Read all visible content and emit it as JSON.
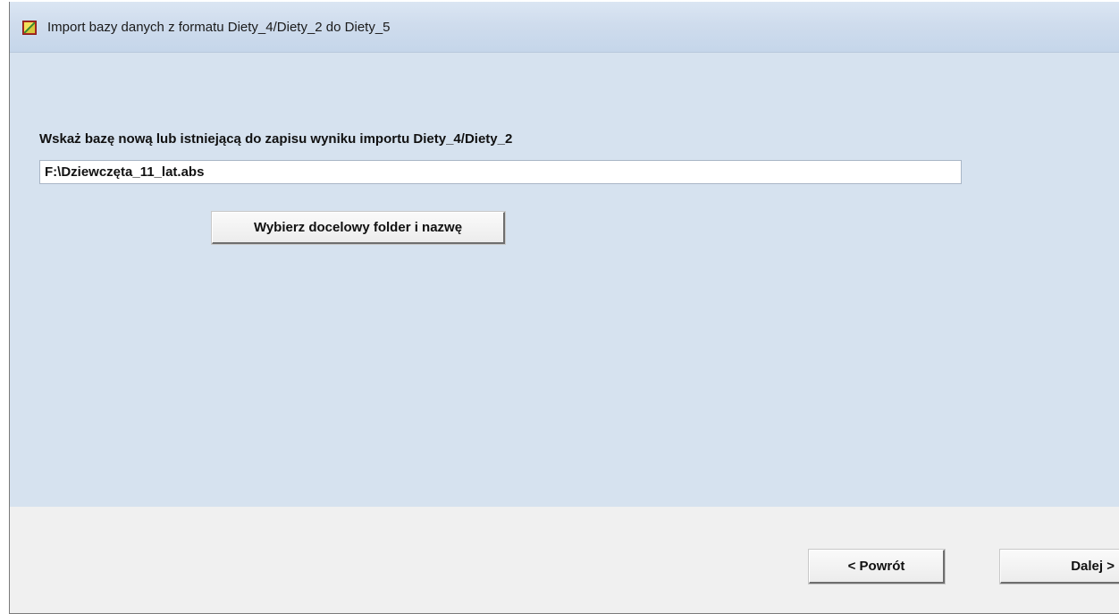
{
  "window": {
    "title": "Import bazy danych z formatu Diety_4/Diety_2 do Diety_5",
    "icon": "app-icon"
  },
  "main": {
    "prompt_label": "Wskaż bazę nową lub istniejącą do zapisu wyniku importu Diety_4/Diety_2",
    "path_value": "F:\\Dziewczęta_11_lat.abs",
    "choose_button_label": "Wybierz docelowy folder i nazwę"
  },
  "footer": {
    "back_label": "< Powrót",
    "next_label": "Dalej >"
  },
  "colors": {
    "content_bg": "#d6e2ef",
    "footer_bg": "#f0f0f0"
  }
}
